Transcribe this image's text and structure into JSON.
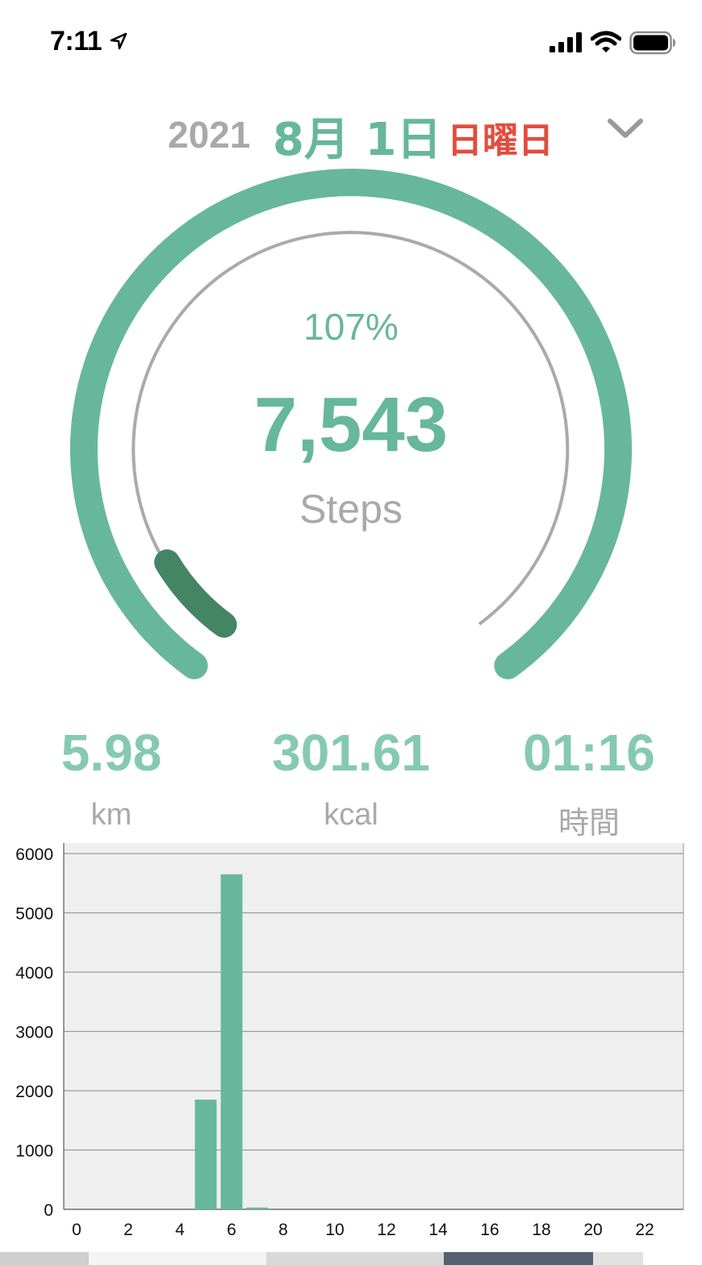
{
  "status_bar": {
    "time": "7:11",
    "icons": [
      "location-arrow-icon",
      "cellular-signal-icon",
      "wifi-icon",
      "battery-icon"
    ]
  },
  "date": {
    "year": "2021",
    "month_day": "8月 1日",
    "weekday": "日曜日",
    "dropdown_icon": "chevron-down-icon"
  },
  "colors": {
    "accent": "#67b79d",
    "accent_dark": "#438565",
    "accent_light": "#86c9b1",
    "weekday": "#e14d3d",
    "muted": "#a9a9a9",
    "chart_bg": "#efefef"
  },
  "gauge": {
    "percent": "107%",
    "steps": "7,543",
    "unit": "Steps",
    "progress_fraction": 1.07
  },
  "stats": [
    {
      "value": "5.98",
      "unit": "km"
    },
    {
      "value": "301.61",
      "unit": "kcal"
    },
    {
      "value": "01:16",
      "unit": "時間"
    }
  ],
  "chart_data": {
    "type": "bar",
    "x": [
      5,
      6,
      7
    ],
    "values": [
      1850,
      5650,
      30
    ],
    "xlim": [
      -0.5,
      23.5
    ],
    "ylim": [
      0,
      6000
    ],
    "x_ticks": [
      "0",
      "2",
      "4",
      "6",
      "8",
      "10",
      "12",
      "14",
      "16",
      "18",
      "20",
      "22"
    ],
    "y_ticks": [
      "0",
      "1000",
      "2000",
      "3000",
      "4000",
      "5000",
      "6000"
    ],
    "grid": true,
    "xlabel": "",
    "ylabel": "",
    "title": ""
  }
}
